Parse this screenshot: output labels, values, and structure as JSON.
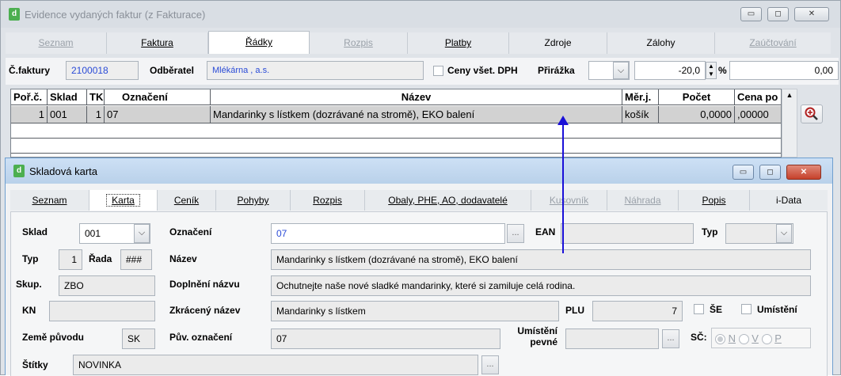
{
  "window_main": {
    "title": "Evidence vydaných faktur (z Fakturace)",
    "tabs": [
      {
        "label": "Seznam",
        "state": "disabled"
      },
      {
        "label": "Faktura",
        "state": "normal"
      },
      {
        "label": "Řádky",
        "state": "active"
      },
      {
        "label": "Rozpis",
        "state": "disabled"
      },
      {
        "label": "Platby",
        "state": "normal"
      },
      {
        "label": "Zdroje",
        "state": "normal"
      },
      {
        "label": "Zálohy",
        "state": "normal"
      },
      {
        "label": "Zaúčtování",
        "state": "disabled"
      }
    ],
    "header": {
      "invoice_label": "Č.faktury",
      "invoice_value": "2100018",
      "customer_label": "Odběratel",
      "customer_value": "Mlékárna , a.s.",
      "prices_vat_label": "Ceny všet. DPH",
      "surcharge_label": "Přirážka",
      "surcharge_percent": "-20,0",
      "percent_sign": "%",
      "amount_value": "0,00"
    },
    "grid": {
      "columns": [
        "Poř.č.",
        "Sklad",
        "TK",
        "Označení",
        "Název",
        "Měr.j.",
        "Počet",
        "Cena po"
      ],
      "rows": [
        {
          "por": "1",
          "sklad": "001",
          "tk": "1",
          "oznaceni": "07",
          "nazev": "Mandarinky s lístkem (dozrávané na stromě), EKO balení",
          "merj": "košík",
          "pocet": "0,0000",
          "cena": ",00000"
        }
      ]
    }
  },
  "window_card": {
    "title": "Skladová karta",
    "tabs": [
      {
        "label": "Seznam",
        "state": "normal"
      },
      {
        "label": "Karta",
        "state": "active"
      },
      {
        "label": "Ceník",
        "state": "normal"
      },
      {
        "label": "Pohyby",
        "state": "normal"
      },
      {
        "label": "Rozpis",
        "state": "normal"
      },
      {
        "label": "Obaly, PHE, AO, dodavatelé",
        "state": "normal"
      },
      {
        "label": "Kusovník",
        "state": "disabled"
      },
      {
        "label": "Náhrada",
        "state": "disabled"
      },
      {
        "label": "Popis",
        "state": "normal"
      },
      {
        "label": "i-Data",
        "state": "normal"
      }
    ],
    "form": {
      "sklad_label": "Sklad",
      "sklad_value": "001",
      "oznaceni_label": "Označení",
      "oznaceni_value": "07",
      "ean_label": "EAN",
      "ean_value": "",
      "typ_right_label": "Typ",
      "typ_right_value": "",
      "typ_label": "Typ",
      "typ_value": "1",
      "rada_label": "Řada",
      "rada_value": "###",
      "nazev_label": "Název",
      "nazev_value": "Mandarinky s lístkem (dozrávané na stromě), EKO balení",
      "skup_label": "Skup.",
      "skup_value": "ZBO",
      "doplneni_label": "Doplnění názvu",
      "doplneni_value": "Ochutnejte naše nové sladké mandarinky, které si zamiluje celá rodina.",
      "kn_label": "KN",
      "kn_value": "",
      "zkraceny_label": "Zkrácený název",
      "zkraceny_value": "Mandarinky s lístkem",
      "plu_label": "PLU",
      "plu_value": "7",
      "se_label": "ŠE",
      "umisteni_label": "Umístění",
      "zeme_label": "Země původu",
      "zeme_value": "SK",
      "puv_label": "Pův. označení",
      "puv_value": "07",
      "umisteni_pevne_label_1": "Umístění",
      "umisteni_pevne_label_2": "pevné",
      "umisteni_pevne_value": "",
      "sc_label": "SČ:",
      "sc_options": [
        "N",
        "V",
        "P"
      ],
      "stitky_label": "Štítky",
      "stitky_value": "NOVINKA"
    }
  },
  "colors": {
    "annotation_arrow": "#1a10d8",
    "field_text_blue": "#2a4bd7",
    "selected_row": "#d2d2d2",
    "close_button": "#c6412b"
  }
}
